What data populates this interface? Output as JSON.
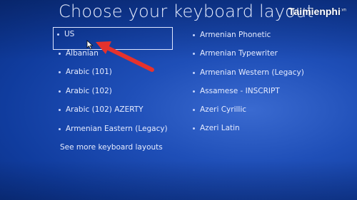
{
  "title": "Choose your keyboard layout",
  "watermark": {
    "brand": "Taimienphi",
    "suffix": ".vn"
  },
  "left_column": [
    {
      "label": "US",
      "selected": true
    },
    {
      "label": "Albanian"
    },
    {
      "label": "Arabic (101)"
    },
    {
      "label": "Arabic (102)"
    },
    {
      "label": "Arabic (102) AZERTY"
    },
    {
      "label": "Armenian Eastern (Legacy)"
    }
  ],
  "right_column": [
    {
      "label": "Armenian Phonetic"
    },
    {
      "label": "Armenian Typewriter"
    },
    {
      "label": "Armenian Western (Legacy)"
    },
    {
      "label": "Assamese - INSCRIPT"
    },
    {
      "label": "Azeri Cyrillic"
    },
    {
      "label": "Azeri Latin"
    }
  ],
  "see_more": "See more keyboard layouts",
  "colors": {
    "background": "#1f4fb8",
    "text": "#e6ecff",
    "arrow": "#e5322d"
  },
  "icons": [
    "bullet-icon",
    "mouse-cursor-icon",
    "red-arrow-annotation"
  ]
}
